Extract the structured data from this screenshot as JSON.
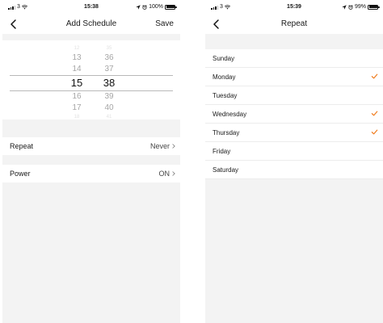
{
  "left_screen": {
    "status": {
      "carrier": "3",
      "time": "15:38",
      "battery": "100%",
      "battery_level": 1.0
    },
    "nav": {
      "title": "Add Schedule",
      "action": "Save"
    },
    "picker": {
      "hours": [
        "12",
        "13",
        "14",
        "15",
        "16",
        "17",
        "18"
      ],
      "minutes": [
        "35",
        "36",
        "37",
        "38",
        "39",
        "40",
        "41"
      ],
      "selected_hour": "15",
      "selected_minute": "38"
    },
    "settings": {
      "repeat": {
        "label": "Repeat",
        "value": "Never"
      },
      "power": {
        "label": "Power",
        "value": "ON"
      }
    }
  },
  "right_screen": {
    "status": {
      "carrier": "3",
      "time": "15:39",
      "battery": "99%",
      "battery_level": 0.99
    },
    "nav": {
      "title": "Repeat"
    },
    "days": [
      {
        "label": "Sunday",
        "checked": false
      },
      {
        "label": "Monday",
        "checked": true
      },
      {
        "label": "Tuesday",
        "checked": false
      },
      {
        "label": "Wednesday",
        "checked": true
      },
      {
        "label": "Thursday",
        "checked": true
      },
      {
        "label": "Friday",
        "checked": false
      },
      {
        "label": "Saturday",
        "checked": false
      }
    ]
  },
  "icons": {
    "back": "chevron-left-icon",
    "disclosure": "chevron-right-icon",
    "check": "checkmark-icon",
    "location": "location-arrow-icon",
    "alarm": "alarm-clock-icon",
    "wifi": "wifi-icon"
  },
  "colors": {
    "accent": "#f07a1a",
    "background": "#f3f3f3",
    "surface": "#ffffff"
  }
}
